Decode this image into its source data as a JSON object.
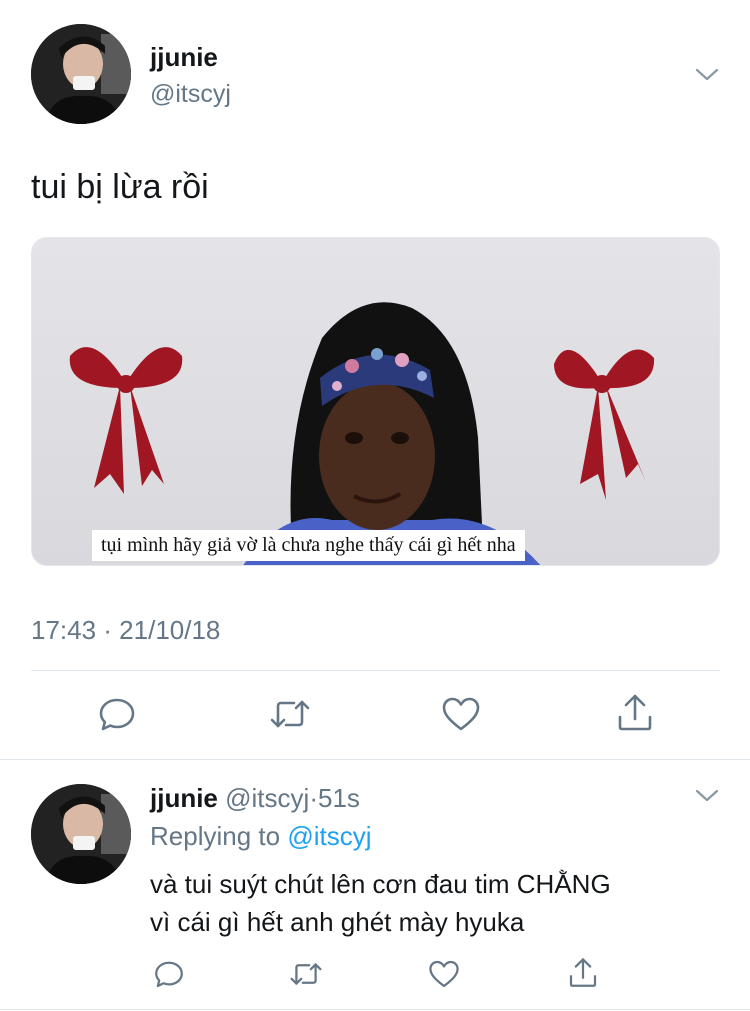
{
  "main_tweet": {
    "display_name": "jjunie",
    "handle": "@itscyj",
    "text": "tui bị lừa rồi",
    "media_caption": "tụi mình hãy giả vờ là chưa nghe thấy cái gì hết nha",
    "timestamp": "17:43 · 21/10/18",
    "actions": [
      "reply-icon",
      "retweet-icon",
      "like-icon",
      "share-icon"
    ]
  },
  "reply_tweet": {
    "display_name": "jjunie",
    "handle": "@itscyj",
    "separator": "·",
    "age": "51s",
    "replying_prefix": "Replying to",
    "replying_to": "@itscyj",
    "text_line1": "và tui suýt chút lên cơn đau tim CHẰNG",
    "text_line2": "vì cái gì hết anh ghét mày hyuka",
    "actions": [
      "reply-icon",
      "retweet-icon",
      "like-icon",
      "share-icon"
    ]
  },
  "colors": {
    "text": "#14171a",
    "muted": "#657786",
    "accent": "#1da1f2",
    "divider": "#e1e8ed"
  }
}
